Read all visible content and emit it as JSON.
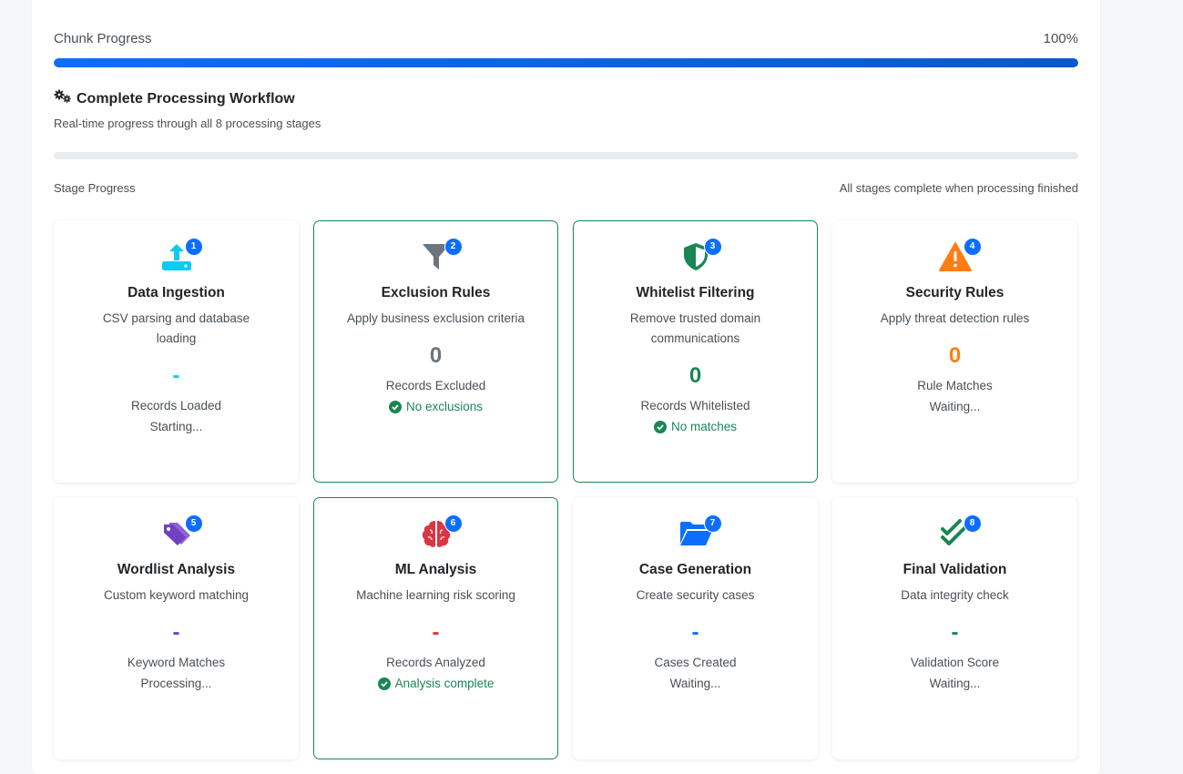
{
  "chunk": {
    "label": "Chunk Progress",
    "percent_text": "100%",
    "fill": 1.0
  },
  "workflow": {
    "title": "Complete Processing Workflow",
    "subtitle": "Real-time progress through all 8 processing stages"
  },
  "stage_progress": {
    "label": "Stage Progress",
    "note": "All stages complete when processing finished"
  },
  "colors": {
    "primary": "#0d6efd",
    "success": "#198754",
    "warning": "#fd7e14",
    "purple": "#6f42c1",
    "danger": "#dc3545",
    "cyan": "#0dcaf0",
    "gray": "#6c757d"
  },
  "stages": [
    {
      "number": "1",
      "icon": "upload-icon",
      "title": "Data Ingestion",
      "desc": "CSV parsing and database loading",
      "value": "-",
      "value_color": "#0dcaf0",
      "label": "Records Loaded",
      "status": "Starting...",
      "done": false
    },
    {
      "number": "2",
      "icon": "filter-icon",
      "title": "Exclusion Rules",
      "desc": "Apply business exclusion criteria",
      "value": "0",
      "value_color": "#6c757d",
      "label": "Records Excluded",
      "status": "No exclusions",
      "done": true
    },
    {
      "number": "3",
      "icon": "shield-icon",
      "title": "Whitelist Filtering",
      "desc": "Remove trusted domain communications",
      "value": "0",
      "value_color": "#198754",
      "label": "Records Whitelisted",
      "status": "No matches",
      "done": true
    },
    {
      "number": "4",
      "icon": "warning-icon",
      "title": "Security Rules",
      "desc": "Apply threat detection rules",
      "value": "0",
      "value_color": "#fd7e14",
      "label": "Rule Matches",
      "status": "Waiting...",
      "done": false
    },
    {
      "number": "5",
      "icon": "tags-icon",
      "title": "Wordlist Analysis",
      "desc": "Custom keyword matching",
      "value": "-",
      "value_color": "#6f42c1",
      "label": "Keyword Matches",
      "status": "Processing...",
      "done": false
    },
    {
      "number": "6",
      "icon": "brain-icon",
      "title": "ML Analysis",
      "desc": "Machine learning risk scoring",
      "value": "-",
      "value_color": "#dc3545",
      "label": "Records Analyzed",
      "status": "Analysis complete",
      "done": true
    },
    {
      "number": "7",
      "icon": "folder-open-icon",
      "title": "Case Generation",
      "desc": "Create security cases",
      "value": "-",
      "value_color": "#0d6efd",
      "label": "Cases Created",
      "status": "Waiting...",
      "done": false
    },
    {
      "number": "8",
      "icon": "check-double-icon",
      "title": "Final Validation",
      "desc": "Data integrity check",
      "value": "-",
      "value_color": "#198754",
      "label": "Validation Score",
      "status": "Waiting...",
      "done": false
    }
  ]
}
